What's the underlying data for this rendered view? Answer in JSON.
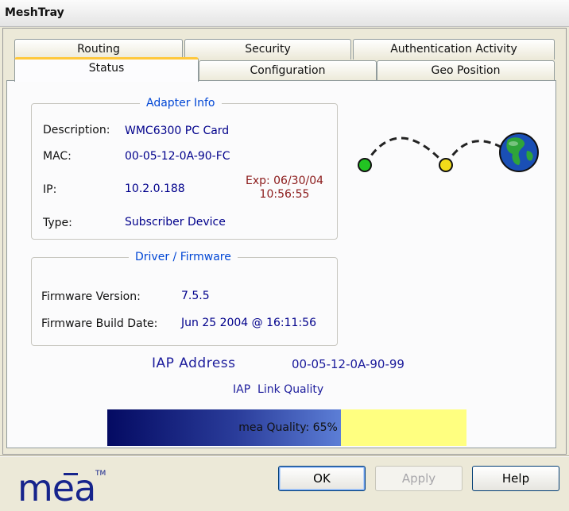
{
  "window": {
    "title": "MeshTray"
  },
  "tabs": {
    "routing": "Routing",
    "security": "Security",
    "auth_activity": "Authentication Activity",
    "status": "Status",
    "configuration": "Configuration",
    "geo_position": "Geo Position",
    "active": "Status"
  },
  "adapter_info": {
    "title": "Adapter Info",
    "description_label": "Description:",
    "description_value": "WMC6300 PC Card",
    "mac_label": "MAC:",
    "mac_value": "00-05-12-0A-90-FC",
    "ip_label": "IP:",
    "ip_value": "10.2.0.188",
    "exp_line1": "Exp: 06/30/04",
    "exp_line2": "10:56:55",
    "type_label": "Type:",
    "type_value": "Subscriber Device"
  },
  "driver_firmware": {
    "title": "Driver / Firmware",
    "version_label": "Firmware Version:",
    "version_value": "7.5.5",
    "build_label": "Firmware Build Date:",
    "build_value": "Jun 25 2004 @ 16:11:56"
  },
  "iap": {
    "address_label": "IAP Address",
    "address_value": "00-05-12-0A-90-99",
    "link_quality_label": "IAP  Link Quality"
  },
  "quality": {
    "percent": 65,
    "text": "mea Quality: 65%",
    "fill_color_start": "#040a62",
    "fill_color_end": "#5c7ed6",
    "remaining_color": "#ffff80"
  },
  "buttons": {
    "ok": "OK",
    "apply": "Apply",
    "help": "Help"
  },
  "logo": {
    "text": "mēa",
    "tm": "TM"
  },
  "icons": [
    "green-node-icon",
    "yellow-node-icon",
    "globe-icon"
  ],
  "colors": {
    "group_title": "#0046d5",
    "value_text": "#00008b",
    "expiry_text": "#8b1a1a",
    "tab_highlight": "#ffc83c"
  }
}
